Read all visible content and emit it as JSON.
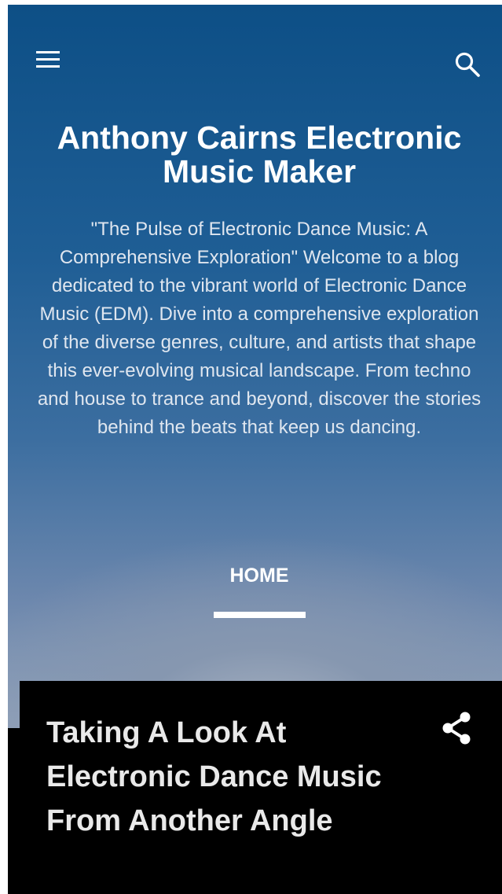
{
  "header": {
    "menu_icon": "hamburger-menu-icon",
    "search_icon": "search-icon",
    "title": "Anthony Cairns Electronic Music Maker",
    "description": "\"The Pulse of Electronic Dance Music: A Comprehensive Exploration\" Welcome to a blog dedicated to the vibrant world of Electronic Dance Music (EDM). Dive into a comprehensive exploration of the diverse genres, culture, and artists that shape this ever-evolving musical landscape. From techno and house to trance and beyond, discover the stories behind the beats that keep us dancing."
  },
  "nav": {
    "items": [
      {
        "label": "HOME",
        "active": true
      }
    ]
  },
  "post": {
    "title": "Taking A Look At Electronic Dance Music From Another Angle",
    "share_icon": "share-icon"
  },
  "colors": {
    "header_top": "#0d4f86",
    "header_bottom": "#93a3ba",
    "card_background": "#000000",
    "title_text": "#ffffff",
    "post_title_text": "#e9e9e9"
  }
}
